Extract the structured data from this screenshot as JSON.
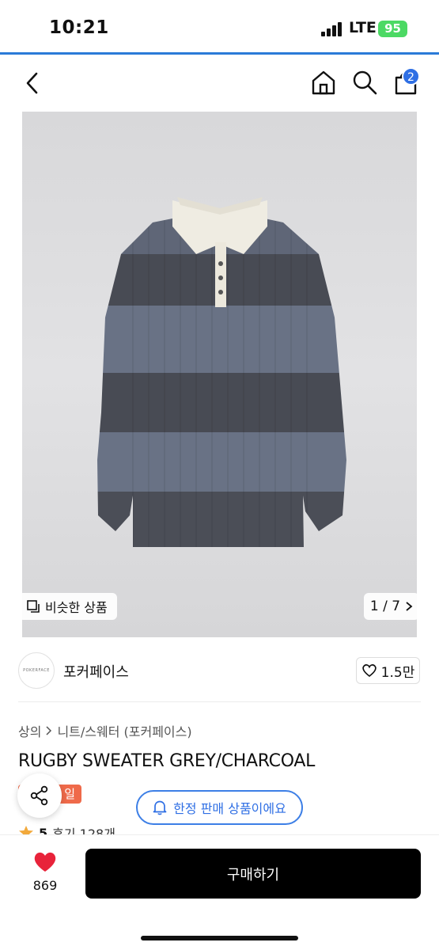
{
  "status_bar": {
    "time": "10:21",
    "network": "LTE",
    "battery": "95"
  },
  "nav": {
    "cart_count": "2"
  },
  "colors": {
    "accent": "#2f6fe4",
    "sale": "#ef6a4a",
    "heart": "#e8233a",
    "buy_button": "#000000"
  },
  "gallery": {
    "similar_label": "비슷한 상품",
    "counter": "1 / 7"
  },
  "brand": {
    "logo_text": "POKERFACE",
    "name": "포커페이스",
    "likes": "1.5만"
  },
  "breadcrumb": [
    "상의",
    "니트/스웨터 (포커페이스)"
  ],
  "product": {
    "title": "RUGBY SWEATER GREY/CHARCOAL",
    "sale_badge": "일",
    "limited_label": "한정 판매 상품이에요",
    "rating": "5",
    "reviews": "후기 128개"
  },
  "bottom": {
    "wishlist_count": "869",
    "buy_label": "구매하기"
  },
  "icons": [
    "back-icon",
    "home-icon",
    "search-icon",
    "cart-icon",
    "similar-icon",
    "chevron-right-icon",
    "heart-outline-icon",
    "share-icon",
    "bell-icon",
    "star-icon",
    "heart-filled-icon"
  ]
}
